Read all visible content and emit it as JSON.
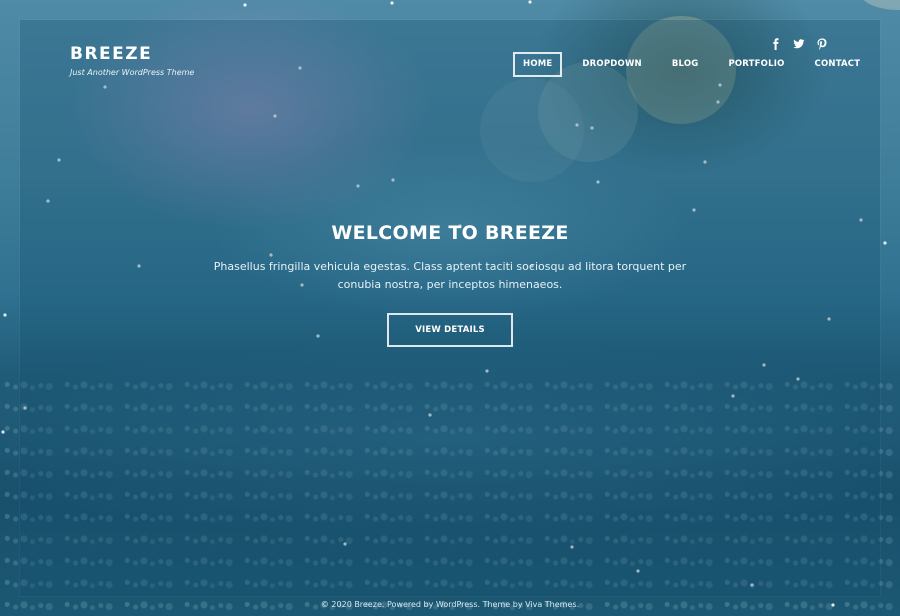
{
  "site": {
    "title": "BREEZE",
    "tagline": "Just Another WordPress Theme"
  },
  "social": [
    {
      "name": "facebook",
      "icon": "facebook-icon"
    },
    {
      "name": "twitter",
      "icon": "twitter-icon"
    },
    {
      "name": "pinterest",
      "icon": "pinterest-icon"
    }
  ],
  "nav": {
    "items": [
      {
        "label": "HOME",
        "active": true
      },
      {
        "label": "DROPDOWN",
        "active": false
      },
      {
        "label": "BLOG",
        "active": false
      },
      {
        "label": "PORTFOLIO",
        "active": false
      },
      {
        "label": "CONTACT",
        "active": false
      }
    ]
  },
  "hero": {
    "title": "WELCOME TO BREEZE",
    "text": "Phasellus fringilla vehicula egestas. Class aptent taciti sociosqu ad litora torquent per conubia nostra, per inceptos himenaeos.",
    "button_label": "VIEW DETAILS"
  },
  "footer": {
    "copyright": "© 2020 Breeze. Powered by ",
    "wordpress_link": "WordPress",
    "theme_text": ". Theme by ",
    "viva_link": "Viva Themes",
    "end": "."
  },
  "colors": {
    "accent": "#ffffff",
    "background_top": "#4f8aa6",
    "background_bottom": "#184f6b"
  }
}
